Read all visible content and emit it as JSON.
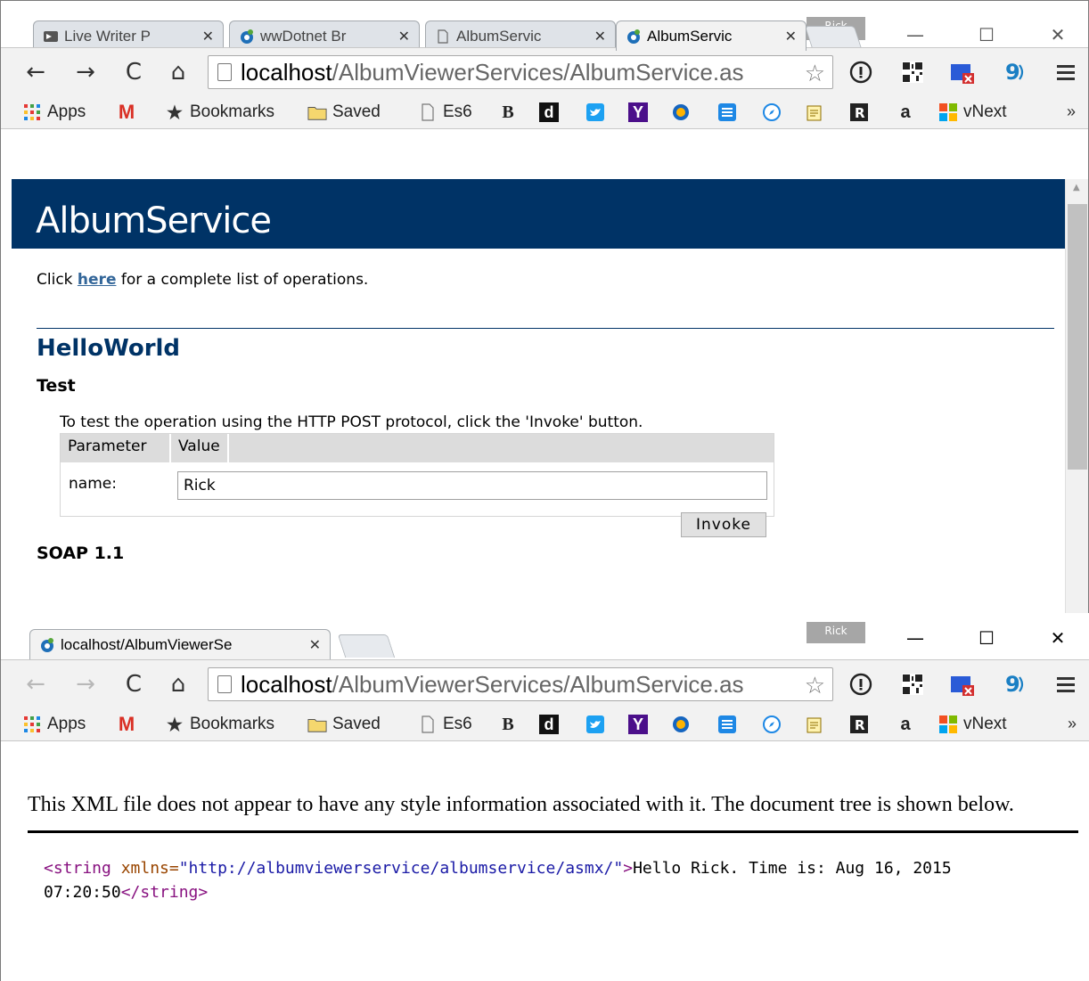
{
  "windows": [
    {
      "profile": "Rick",
      "controls": {
        "minimize": "—",
        "maximize": "☐",
        "close": "✕"
      },
      "tabs": [
        {
          "label": "Live Writer P",
          "close": "✕",
          "icon": "live-writer-icon"
        },
        {
          "label": "wwDotnet Br",
          "close": "✕",
          "icon": "chrome-favicon"
        },
        {
          "label": "AlbumServic",
          "close": "✕",
          "icon": "page-icon"
        },
        {
          "label": "AlbumServic",
          "close": "✕",
          "icon": "chrome-favicon",
          "active": true
        }
      ],
      "address": {
        "host": "localhost",
        "path": "/AlbumViewerServices/AlbumService.as"
      }
    },
    {
      "profile": "Rick",
      "controls": {
        "minimize": "—",
        "maximize": "☐",
        "close": "✕"
      },
      "tabs": [
        {
          "label": "localhost/AlbumViewerSe",
          "close": "✕",
          "icon": "chrome-favicon",
          "active": true
        }
      ],
      "address": {
        "host": "localhost",
        "path": "/AlbumViewerServices/AlbumService.as"
      }
    }
  ],
  "bookmarks": {
    "apps": "Apps",
    "bookmarks": "Bookmarks",
    "saved": "Saved",
    "es6": "Es6",
    "b": "B",
    "d": "d",
    "y": "Y",
    "a": "a",
    "vnext": "vNext",
    "overflow": "»"
  },
  "service_page": {
    "title": "AlbumService",
    "click_prefix": "Click ",
    "click_link": "here",
    "click_suffix": " for a complete list of operations.",
    "operation": "HelloWorld",
    "test_heading": "Test",
    "test_description": "To test the operation using the HTTP POST protocol, click the 'Invoke' button.",
    "table_headers": [
      "Parameter",
      "Value"
    ],
    "param_label": "name:",
    "param_value": "Rick",
    "invoke_label": "Invoke",
    "soap_heading": "SOAP 1.1"
  },
  "xml_page": {
    "notice": "This XML file does not appear to have any style information associated with it. The document tree is shown below.",
    "tag_open": "<string",
    "attr_name": " xmlns=",
    "attr_value": "\"http://albumviewerservice/albumservice/asmx/\"",
    "tag_close_bracket": ">",
    "text": "Hello Rick. Time is: Aug 16, 2015 07:20:50",
    "tag_end": "</string>"
  },
  "colors": {
    "header_bg": "#003366",
    "link": "#336699",
    "xml_tag": "#881280",
    "xml_attr": "#994500",
    "xml_value": "#1a1aa6"
  }
}
